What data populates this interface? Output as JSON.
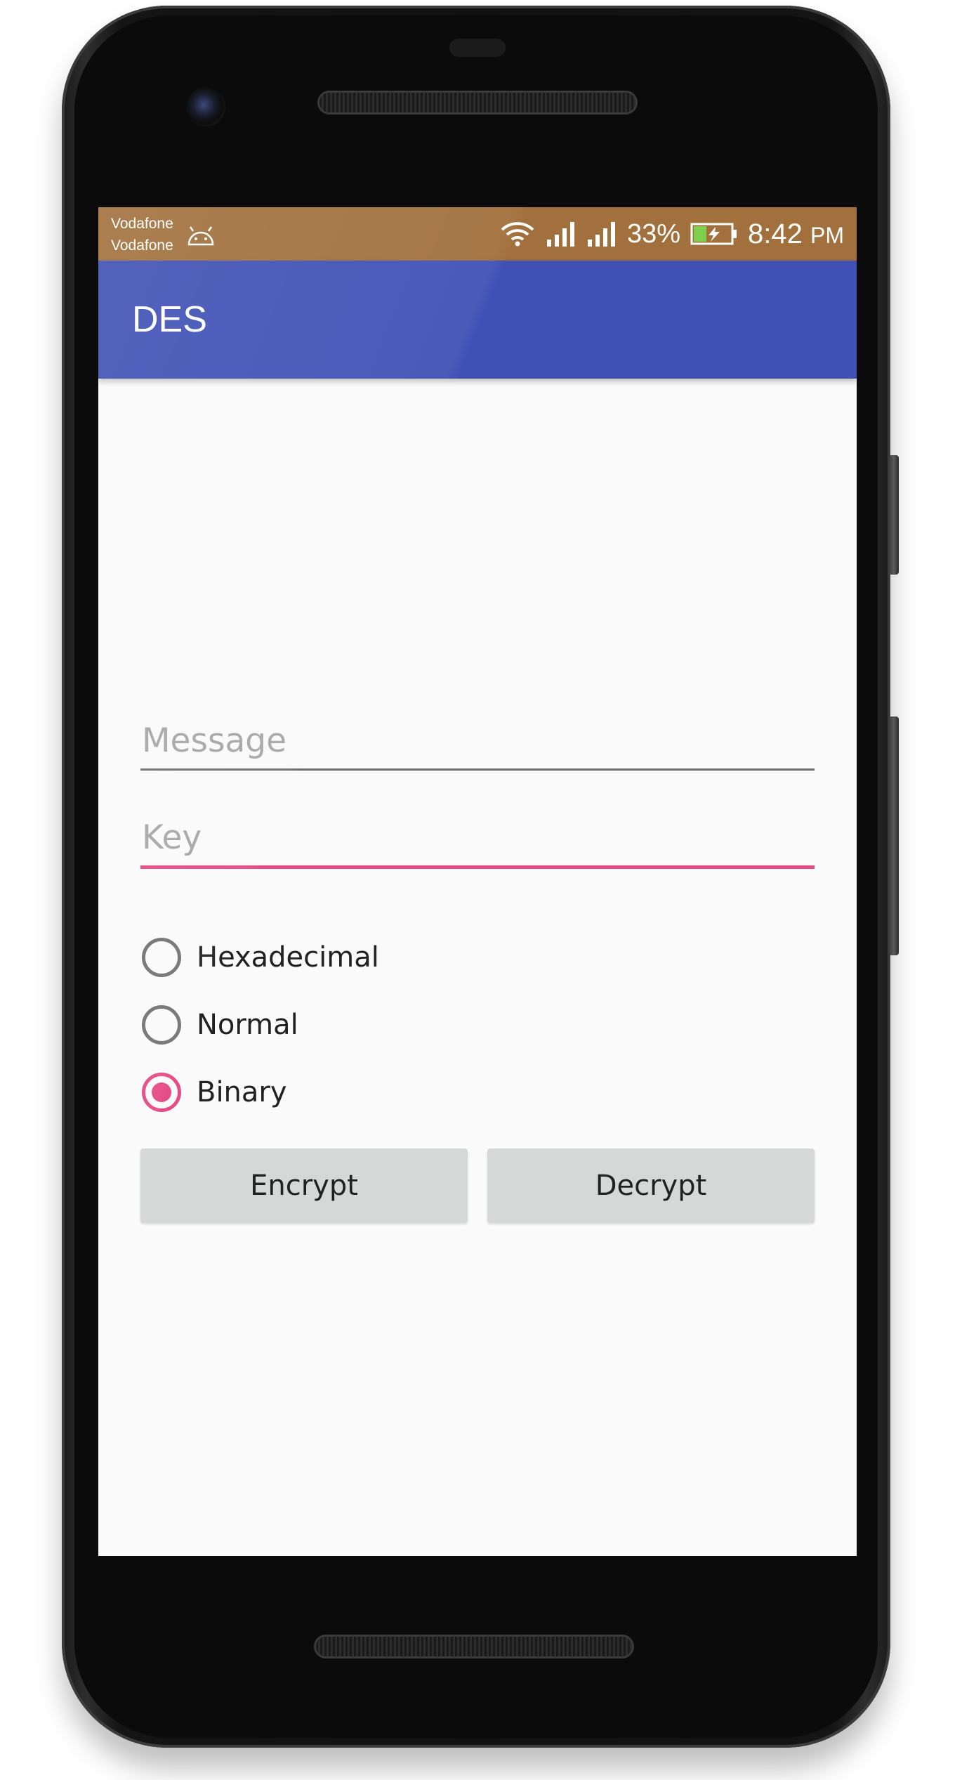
{
  "status_bar": {
    "carrier_line1": "Vodafone",
    "carrier_line2": "Vodafone",
    "battery_percent": "33%",
    "time": "8:42",
    "time_suffix": "PM",
    "background_color": "#a2703c"
  },
  "app_bar": {
    "title": "DES",
    "color": "#3f51b5"
  },
  "form": {
    "message_placeholder": "Message",
    "message_value": "",
    "key_placeholder": "Key",
    "key_value": "",
    "accent_color": "#e64b85",
    "radio_options": [
      {
        "label": "Hexadecimal",
        "checked": false
      },
      {
        "label": "Normal",
        "checked": false
      },
      {
        "label": "Binary",
        "checked": true
      }
    ],
    "encrypt_label": "Encrypt",
    "decrypt_label": "Decrypt"
  },
  "icons": [
    "android-debug-icon",
    "wifi-icon",
    "signal-icon",
    "signal-icon",
    "battery-charging-icon"
  ]
}
